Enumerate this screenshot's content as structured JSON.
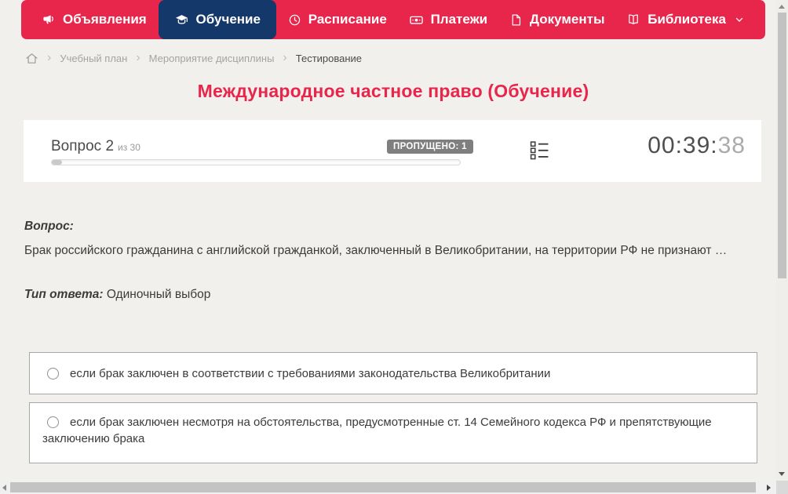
{
  "theme": {
    "accent": "#e8254b",
    "nav-active": "#15386b",
    "badge": "#7f7f7f"
  },
  "nav": {
    "items": [
      {
        "label": "Объявления",
        "icon": "megaphone-icon",
        "active": false
      },
      {
        "label": "Обучение",
        "icon": "graduation-cap-icon",
        "active": true
      },
      {
        "label": "Расписание",
        "icon": "clock-icon",
        "active": false
      },
      {
        "label": "Платежи",
        "icon": "banknote-icon",
        "active": false
      },
      {
        "label": "Документы",
        "icon": "document-icon",
        "active": false
      },
      {
        "label": "Библиотека",
        "icon": "book-icon",
        "active": false,
        "has_dropdown": true,
        "dropdown_icon": "chevron-down-icon"
      }
    ]
  },
  "breadcrumb": {
    "home_icon": "home-icon",
    "items": [
      "Учебный план",
      "Мероприятие дисциплины",
      "Тестирование"
    ]
  },
  "page_title": "Международное частное право (Обучение)",
  "question_panel": {
    "question_label": "Вопрос 2",
    "question_total": "из 30",
    "skipped_badge": "ПРОПУЩЕНО: 1",
    "progress_fill_style": "width:2.5%",
    "list_icon": "question-list-icon",
    "timer_main": "00:39:",
    "timer_seconds": "38"
  },
  "question": {
    "label": "Вопрос:",
    "text": "Брак российского гражданина с английской гражданкой, заключенный в Великобритании, на территории РФ не признают …",
    "answer_type_label": "Тип ответа:",
    "answer_type_value": "Одиночный выбор"
  },
  "answers": [
    {
      "text": "если брак заключен в соответствии с требованиями законодательства Великобритании",
      "selected": false
    },
    {
      "text": "если брак заключен несмотря на обстоятельства, предусмотренные ст. 14 Семейного кодекса РФ и препятствующие заключению брака",
      "selected": false
    }
  ]
}
